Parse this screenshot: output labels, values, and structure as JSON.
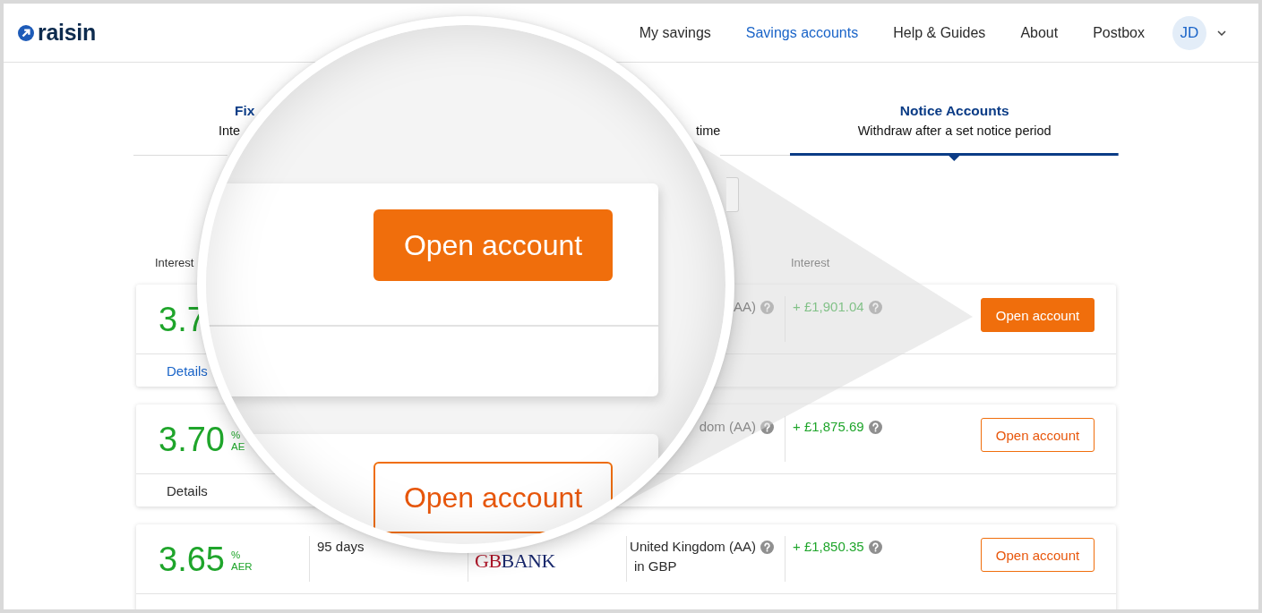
{
  "header": {
    "logo": "raisin",
    "nav": [
      {
        "label": "My savings",
        "selected": false
      },
      {
        "label": "Savings accounts",
        "selected": true
      },
      {
        "label": "Help & Guides",
        "selected": false
      },
      {
        "label": "About",
        "selected": false
      },
      {
        "label": "Postbox",
        "selected": false
      }
    ],
    "avatar": "JD"
  },
  "tabs": [
    {
      "title": "Fix",
      "subtitle": "Inte",
      "selected": false
    },
    {
      "subtitle": "time",
      "selected": false
    },
    {
      "title": "Notice Accounts",
      "subtitle": "Withdraw after a set notice period",
      "selected": true
    }
  ],
  "column_headers": {
    "column_1": "Interest",
    "column_5": "Interest"
  },
  "cards": [
    {
      "hovered": true,
      "rate": "3.7",
      "country": [
        "AA)"
      ],
      "interest": "+ £1,901.04",
      "button": "Open account",
      "details": "Details"
    },
    {
      "hovered": false,
      "rate": "3.70",
      "rate_symbol": "%",
      "rate_unit": "AE",
      "country": [
        "dom (AA)"
      ],
      "interest": "+ £1,875.69",
      "button": "Open account",
      "details": "Details"
    },
    {
      "hovered": false,
      "rate": "3.65",
      "rate_symbol": "%",
      "rate_unit": "AER",
      "term": "95 days",
      "bank_logo": [
        "GB",
        "BANK"
      ],
      "country": [
        "United Kingdom (AA)",
        "in GBP"
      ],
      "interest": "+ £1,850.35",
      "button": "Open account"
    }
  ],
  "magnifier": {
    "cards": [
      {
        "hovered": true,
        "button": "Open account"
      },
      {
        "hovered": false,
        "button": "Open account"
      }
    ]
  }
}
